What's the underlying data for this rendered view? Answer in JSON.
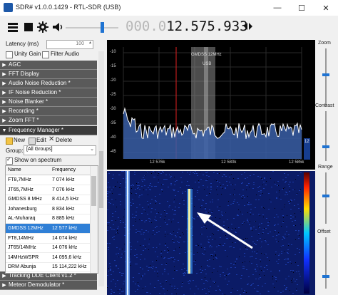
{
  "window": {
    "title": "SDR# v1.0.0.1429 - RTL-SDR (USB)",
    "minimize_glyph": "—",
    "maximize_glyph": "☐",
    "close_glyph": "✕"
  },
  "toolbar": {
    "freq_dim": "000.0",
    "freq_main": "12.575.933"
  },
  "left": {
    "latency_label": "Latency (ms)",
    "latency_value": "100",
    "unity_gain": "Unity Gain",
    "filter_audio": "Filter Audio",
    "sections_top": [
      "AGC",
      "FFT Display",
      "Audio Noise Reduction *",
      "IF Noise Reduction *",
      "Noise Blanker *",
      "Recording *",
      "Zoom FFT *"
    ],
    "frequency_manager": "Frequency Manager *",
    "fm_new": "New",
    "fm_edit": "Edit",
    "fm_delete": "Delete",
    "group_label": "Group:",
    "group_value": "[All Groups]",
    "show_on_spectrum": "Show on spectrum",
    "table_headers": [
      "Name",
      "Frequency"
    ],
    "table_rows": [
      {
        "name": "FT8,7MHz",
        "freq": "7 074 kHz"
      },
      {
        "name": "JT65,7MHz",
        "freq": "7 076 kHz"
      },
      {
        "name": "GMDSS 8 MHz",
        "freq": "8 414,5 kHz"
      },
      {
        "name": "Johanesburg",
        "freq": "8 834 kHz"
      },
      {
        "name": "AL-Muharaq",
        "freq": "8 885 kHz"
      },
      {
        "name": "GMDSS 12MHz",
        "freq": "12 577 kHz"
      },
      {
        "name": "FT8,14MHz",
        "freq": "14 074 kHz"
      },
      {
        "name": "JT65/14MHz",
        "freq": "14 076 kHz"
      },
      {
        "name": "14MHzWSPR",
        "freq": "14 095,6 kHz"
      },
      {
        "name": "DRM Abunja",
        "freq": "15 114,222 kHz"
      }
    ],
    "selected_index": 5,
    "sections_bottom": [
      "Tracking DDE Client v1.2 *",
      "Meteor Demodulator *"
    ]
  },
  "spectrum": {
    "y_ticks": [
      "-10",
      "-15",
      "-20",
      "-25",
      "-30",
      "-35",
      "-40",
      "-45"
    ],
    "x_ticks": [
      "12 576k",
      "12 580k",
      "12 585k"
    ],
    "marker_name": "GMDSS 12MHz",
    "marker_mode": "USB",
    "right_value": "12"
  },
  "right": {
    "zoom": "Zoom",
    "contrast": "Contrast",
    "range": "Range",
    "offset": "Offset"
  },
  "colors": {
    "section_bg": "#5a5a5a",
    "selection": "#2f7fd6",
    "spectrum_fill": "#3a5fa8",
    "passband": "#8a8a8a",
    "accent_blue": "#1f73d2"
  },
  "icons": [
    "menu-icon",
    "stop-icon",
    "gear-icon",
    "speaker-icon",
    "tune-arrows-icon"
  ]
}
